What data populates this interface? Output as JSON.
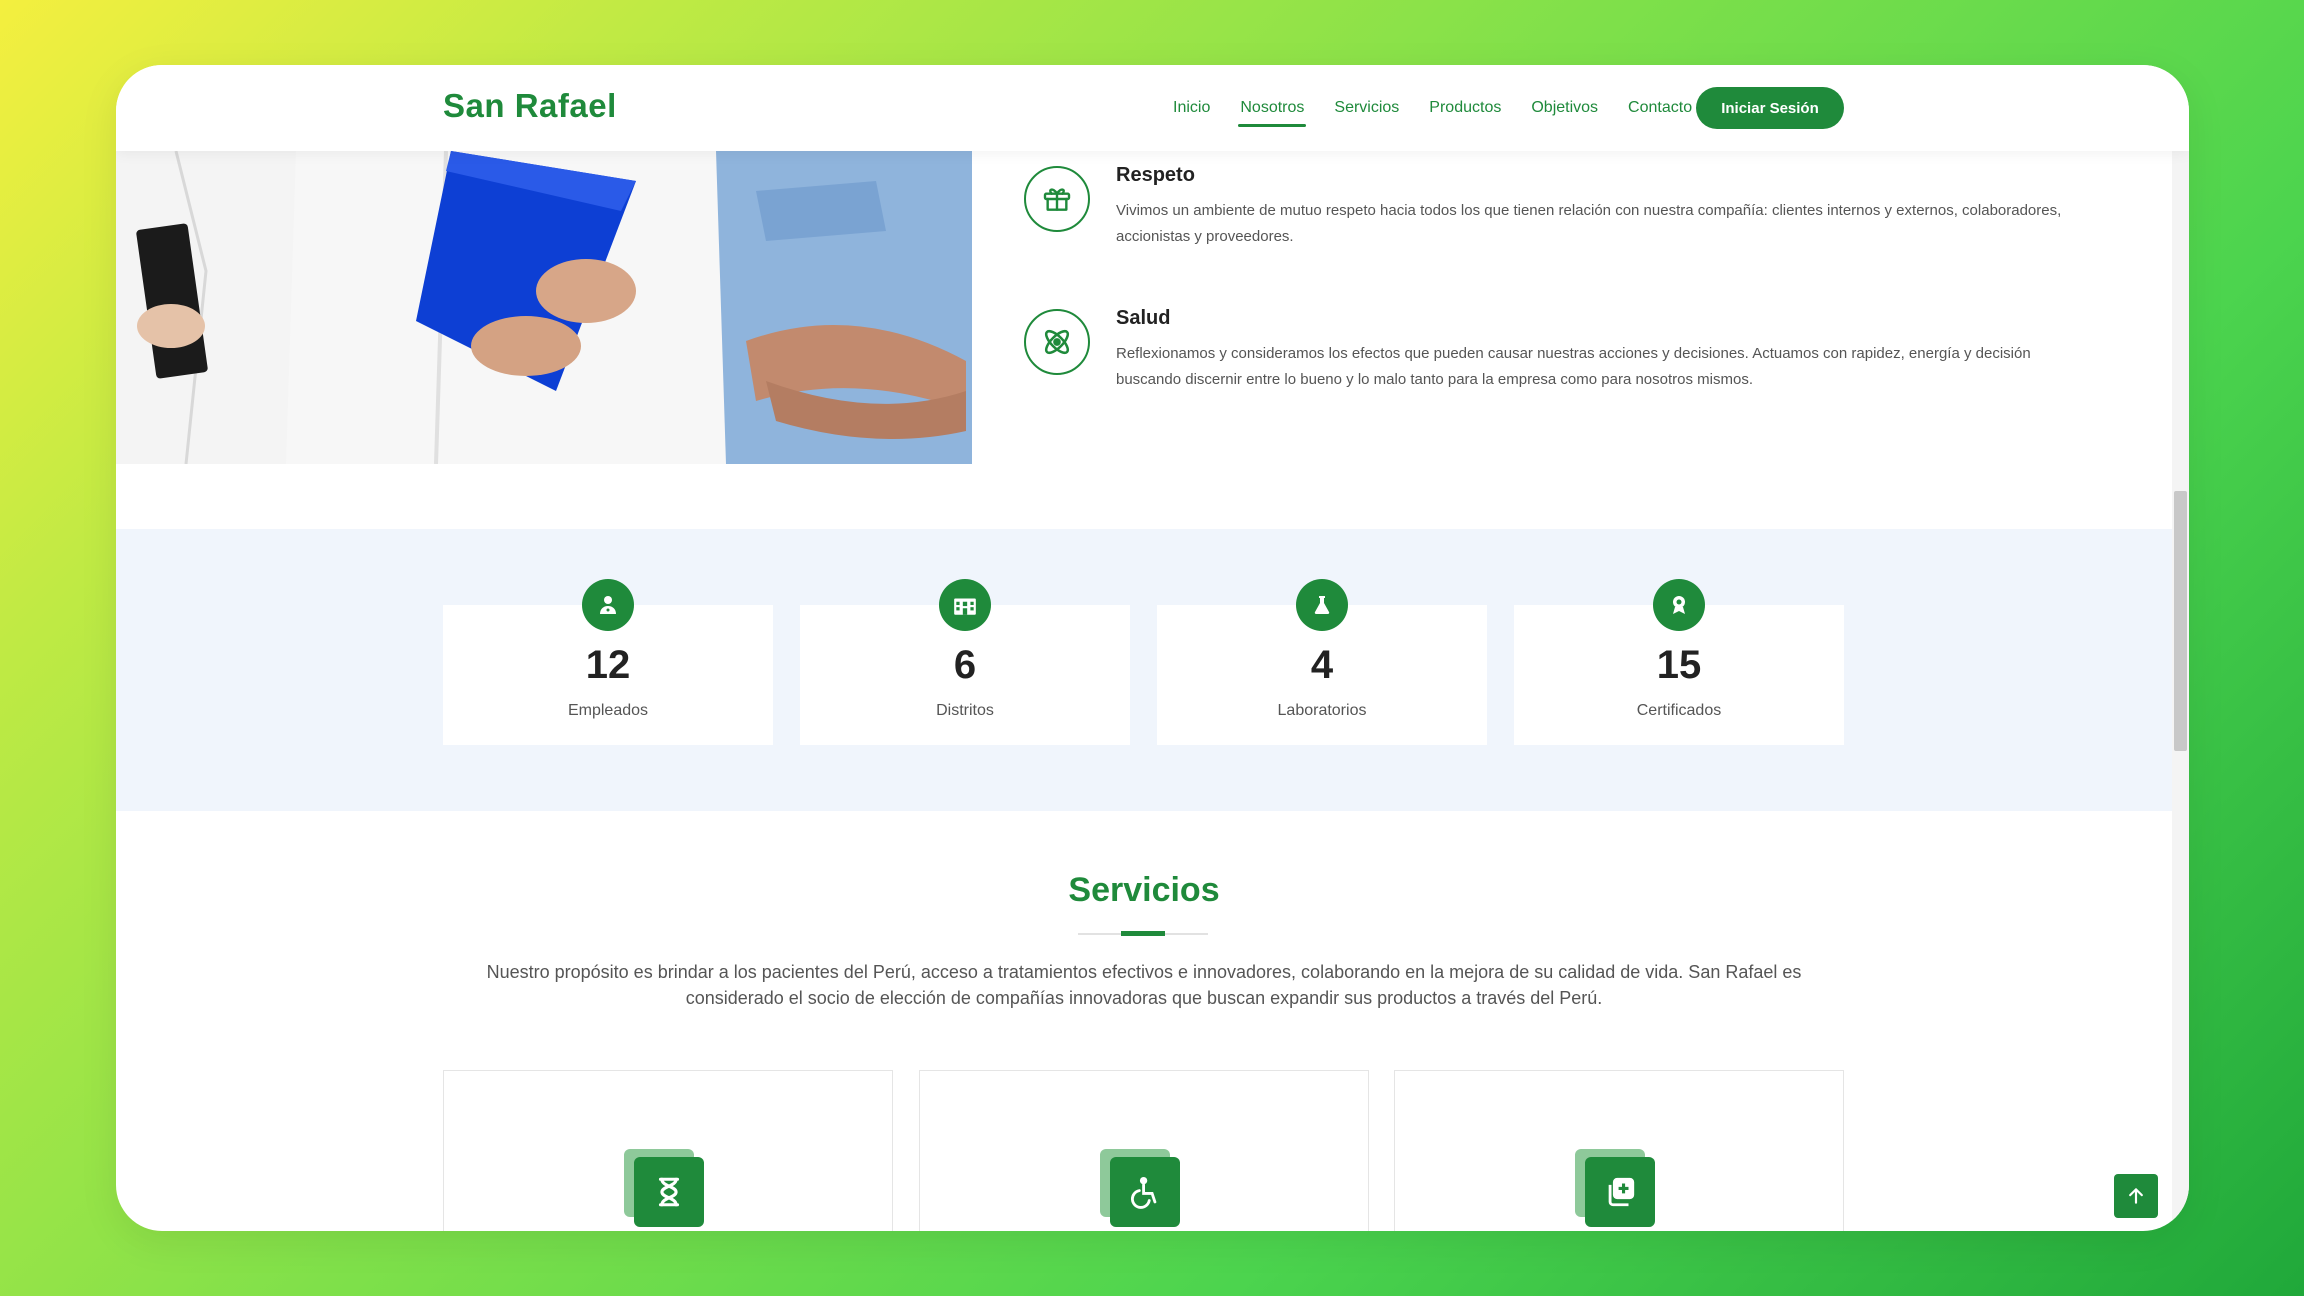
{
  "header": {
    "logo": "San Rafael",
    "nav": [
      "Inicio",
      "Nosotros",
      "Servicios",
      "Productos",
      "Objetivos",
      "Contacto"
    ],
    "active_nav": "Nosotros",
    "login_label": "Iniciar Sesión"
  },
  "values": [
    {
      "title": "Respeto",
      "text": "Vivimos un ambiente de mutuo respeto hacia todos los que tienen relación con nuestra compañía: clientes internos y externos, colaboradores, accionistas y proveedores.",
      "icon": "gift-icon"
    },
    {
      "title": "Salud",
      "text": "Reflexionamos y consideramos los efectos que pueden causar nuestras acciones y decisiones. Actuamos con rapidez, energía y decisión buscando discernir entre lo bueno y lo malo tanto para la empresa como para nosotros mismos.",
      "icon": "atom-icon"
    }
  ],
  "stats": [
    {
      "number": "12",
      "label": "Empleados",
      "icon": "doctor-icon"
    },
    {
      "number": "6",
      "label": "Distritos",
      "icon": "hospital-icon"
    },
    {
      "number": "4",
      "label": "Laboratorios",
      "icon": "flask-icon"
    },
    {
      "number": "15",
      "label": "Certificados",
      "icon": "award-icon"
    }
  ],
  "services": {
    "title": "Servicios",
    "description": "Nuestro propósito es brindar a los pacientes del Perú, acceso a tratamientos efectivos e innovadores, colaborando en la mejora de su calidad de vida. San Rafael es considerado el socio de elección de compañías innovadoras que buscan expandir sus productos a través del Perú.",
    "cards": [
      {
        "icon": "dna-icon"
      },
      {
        "icon": "wheelchair-icon"
      },
      {
        "icon": "medical-copy-icon"
      }
    ]
  },
  "colors": {
    "brand_green": "#1f8a3b",
    "stats_bg": "#f0f5fc"
  }
}
